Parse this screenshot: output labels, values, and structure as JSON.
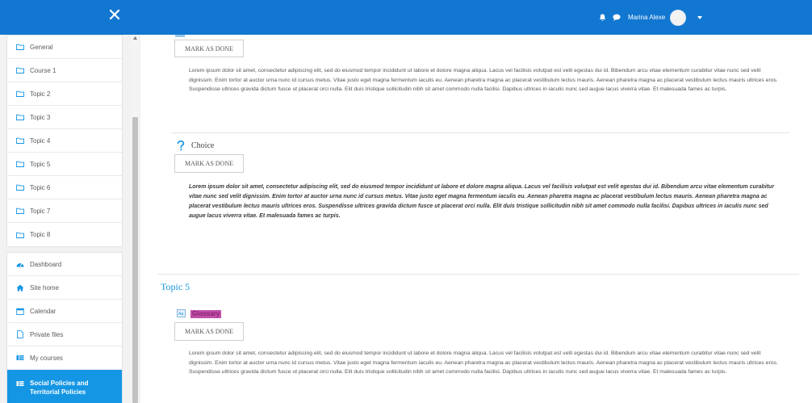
{
  "topbar": {
    "close_icon": "close-icon",
    "username": "Marina Alexe",
    "icons": [
      "bell-icon",
      "chat-icon",
      "chevron-down-icon"
    ],
    "color": "#1177d1"
  },
  "sidebar": {
    "sections": [
      {
        "label": "General",
        "icon": "folder-icon"
      },
      {
        "label": "Course 1",
        "icon": "folder-icon"
      },
      {
        "label": "Topic 2",
        "icon": "folder-icon"
      },
      {
        "label": "Topic 3",
        "icon": "folder-icon"
      },
      {
        "label": "Topic 4",
        "icon": "folder-icon"
      },
      {
        "label": "Topic 5",
        "icon": "folder-icon"
      },
      {
        "label": "Topic 6",
        "icon": "folder-icon"
      },
      {
        "label": "Topic 7",
        "icon": "folder-icon"
      },
      {
        "label": "Topic 8",
        "icon": "folder-icon"
      }
    ],
    "nav": [
      {
        "label": "Dashboard",
        "icon": "dashboard-icon"
      },
      {
        "label": "Site home",
        "icon": "home-icon"
      },
      {
        "label": "Calendar",
        "icon": "calendar-icon"
      },
      {
        "label": "Private files",
        "icon": "file-icon"
      },
      {
        "label": "My courses",
        "icon": "courses-icon"
      }
    ],
    "active": {
      "label_line1": "Social Policies and",
      "label_line2": "Territorial Policies",
      "icon": "courses-icon"
    },
    "active_color": "#1596e4"
  },
  "main": {
    "mark_as_done": "MARK AS DONE",
    "lorem": "Lorem ipsum dolor sit amet, consectetur adipiscing elit, sed do eiusmod tempor incididunt ut labore et dolore magna aliqua. Lacus vel facilisis volutpat est velit egestas dui id. Bibendum arcu vitae elementum curabitur vitae nunc sed velit dignissim. Enim tortor at auctor urna nunc id cursus metus. Vitae justo eget magna fermentum iaculis eu. Aenean pharetra magna ac placerat vestibulum lectus mauris. Aenean pharetra magna ac placerat vestibulum lectus mauris ultrices eros. Suspendisse ultrices gravida dictum fusce ut placerat orci nulla. Elit duis tristique sollicitudin nibh sit amet commodo nulla facilisi. Dapibus ultrices in iaculis nunc sed augue lacus viverra vitae. Et malesuada fames ac turpis.",
    "choice_title": "Choice",
    "choice_icon": "question-icon",
    "topic5_title": "Topic 5",
    "glossary_title": "Glossary",
    "glossary_icon": "glossary-icon",
    "topic_color": "#1596e4"
  }
}
